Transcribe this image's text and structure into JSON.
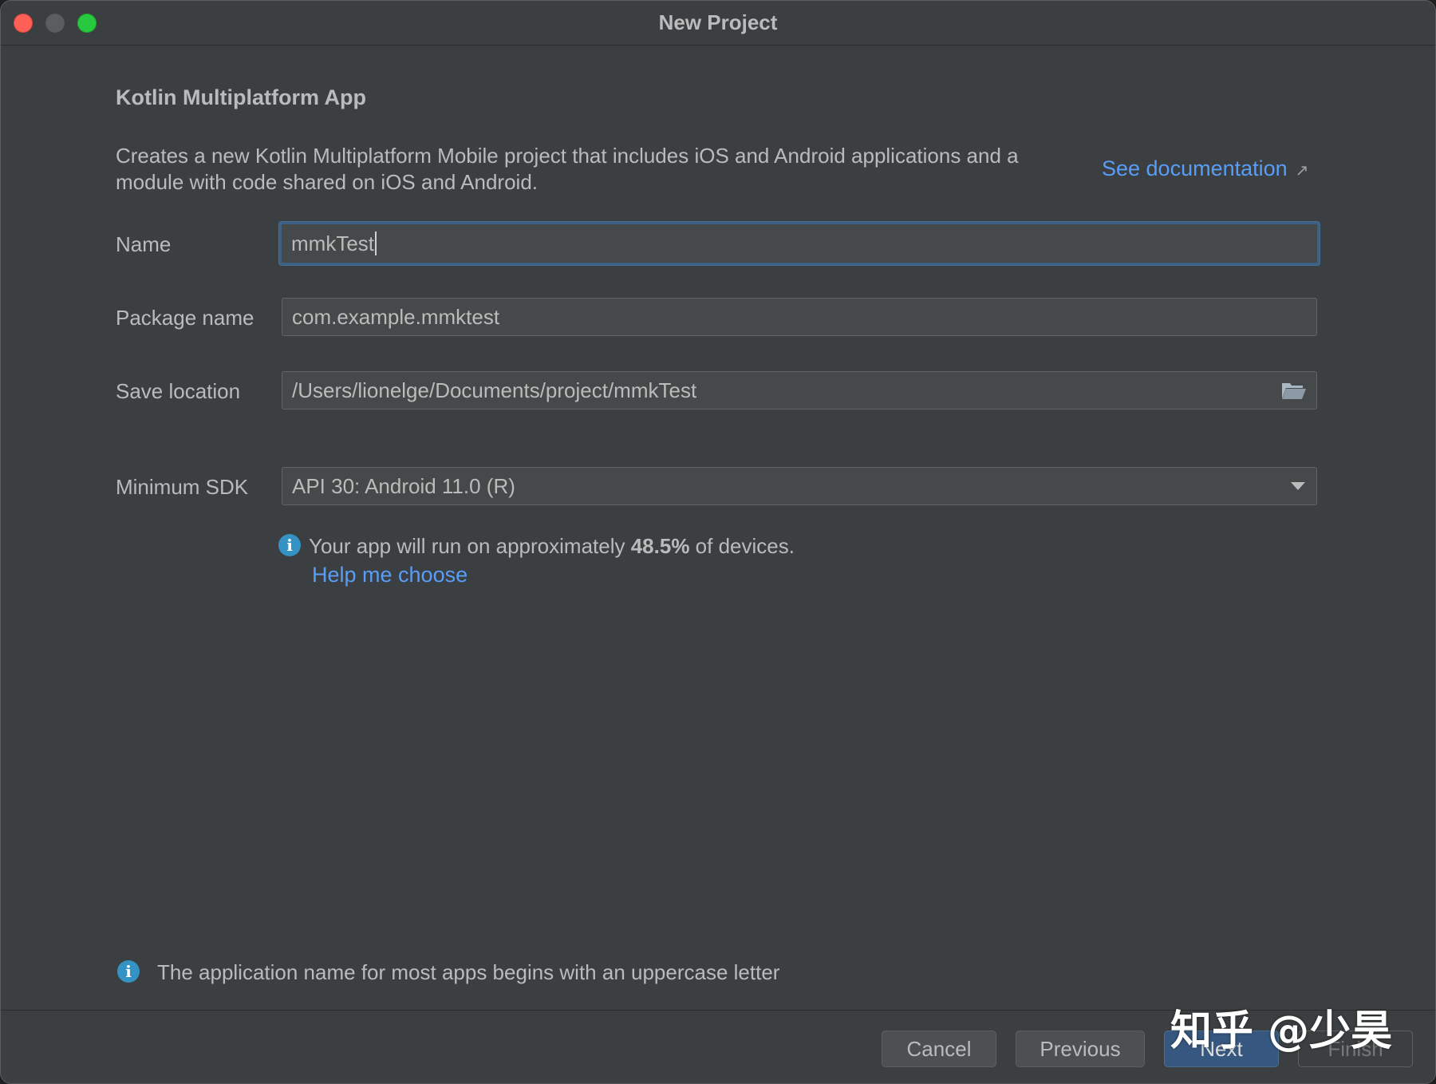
{
  "window": {
    "title": "New Project"
  },
  "heading": "Kotlin Multiplatform App",
  "description": "Creates a new Kotlin Multiplatform Mobile project that includes iOS and Android applications and a module with code shared on iOS and Android.",
  "doc_link": "See documentation",
  "form": {
    "name_label": "Name",
    "name_value": "mmkTest",
    "package_label": "Package name",
    "package_value": "com.example.mmktest",
    "location_label": "Save location",
    "location_value": "/Users/lionelge/Documents/project/mmkTest",
    "sdk_label": "Minimum SDK",
    "sdk_value": "API 30: Android 11.0 (R)"
  },
  "sdk_info": {
    "prefix": "Your app will run on approximately ",
    "percent": "48.5%",
    "suffix": " of devices.",
    "help_link": "Help me choose"
  },
  "validation_hint": "The application name for most apps begins with an uppercase letter",
  "buttons": {
    "cancel": "Cancel",
    "previous": "Previous",
    "next": "Next",
    "finish": "Finish"
  },
  "watermark": "知乎 @少昊",
  "colors": {
    "background": "#3c3f41",
    "link": "#589df6",
    "primary_button": "#365880",
    "info_icon": "#3592c4"
  },
  "icons": {
    "info": "info-circle-icon",
    "folder": "folder-open-icon",
    "dropdown": "chevron-down-icon",
    "external": "external-link-arrow-icon"
  }
}
